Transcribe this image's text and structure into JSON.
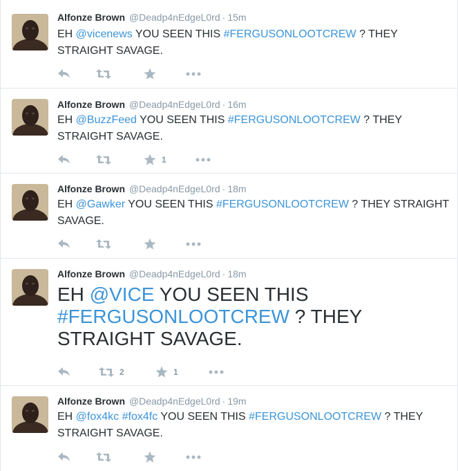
{
  "tweets": [
    {
      "fullname": "Alfonze Brown",
      "username": "@Deadp4nEdgeL0rd",
      "time": "15m",
      "text_1": "EH ",
      "mention_1": "@vicenews",
      "text_2": " YOU SEEN THIS ",
      "hashtag": "#FERGUSONLOOTCREW",
      "text_3": " ? THEY STRAIGHT SAVAGE.",
      "retweets": "",
      "favorites": ""
    },
    {
      "fullname": "Alfonze Brown",
      "username": "@Deadp4nEdgeL0rd",
      "time": "16m",
      "text_1": "EH ",
      "mention_1": "@BuzzFeed",
      "text_2": " YOU SEEN THIS ",
      "hashtag": "#FERGUSONLOOTCREW",
      "text_3": " ? THEY STRAIGHT SAVAGE.",
      "retweets": "",
      "favorites": "1"
    },
    {
      "fullname": "Alfonze Brown",
      "username": "@Deadp4nEdgeL0rd",
      "time": "18m",
      "text_1": "EH ",
      "mention_1": "@Gawker",
      "text_2": "  YOU SEEN THIS ",
      "hashtag": "#FERGUSONLOOTCREW",
      "text_3": " ? THEY STRAIGHT SAVAGE.",
      "retweets": "",
      "favorites": ""
    },
    {
      "fullname": "Alfonze Brown",
      "username": "@Deadp4nEdgeL0rd",
      "time": "18m",
      "text_1": "EH ",
      "mention_1": "@VICE",
      "text_2": "  YOU SEEN THIS ",
      "hashtag": "#FERGUSONLOOTCREW",
      "text_3": " ? THEY STRAIGHT SAVAGE.",
      "retweets": "2",
      "favorites": "1"
    },
    {
      "fullname": "Alfonze Brown",
      "username": "@Deadp4nEdgeL0rd",
      "time": "19m",
      "text_1": "EH ",
      "mention_1": "@fox4kc",
      "text_mid": " ",
      "mention_2": "#fox4fc",
      "text_2": "  YOU SEEN THIS ",
      "hashtag": "#FERGUSONLOOTCREW",
      "text_3": " ? THEY STRAIGHT SAVAGE.",
      "retweets": "",
      "favorites": ""
    }
  ],
  "colors": {
    "link": "#3b94d9",
    "text": "#292f33",
    "meta": "#8899a6",
    "icon": "#aab8c2",
    "divider": "#e1e8ed"
  },
  "icons": {
    "reply": "reply-icon",
    "retweet": "retweet-icon",
    "favorite": "star-icon",
    "more": "more-icon"
  }
}
